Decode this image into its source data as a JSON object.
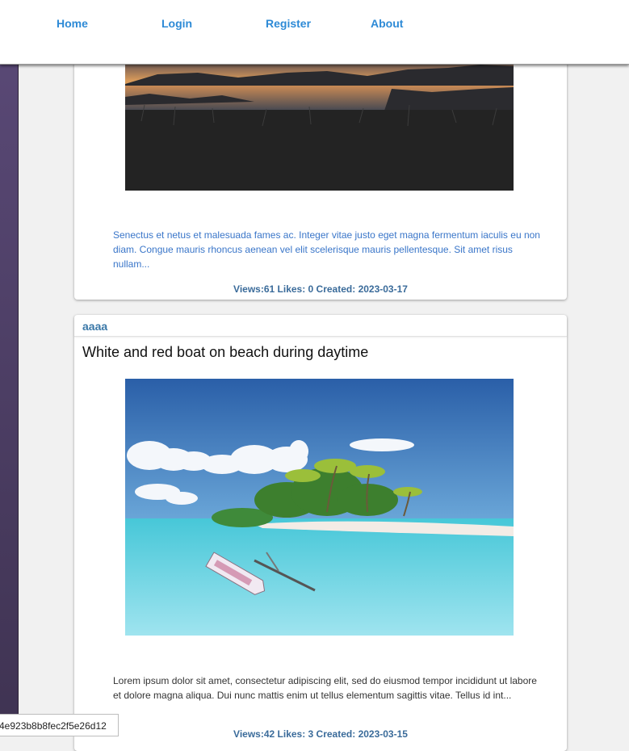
{
  "nav": {
    "home": "Home",
    "login": "Login",
    "register": "Register",
    "about": "About"
  },
  "posts": [
    {
      "image": "sunset-lake-image",
      "excerpt": "Senectus et netus et malesuada fames ac. Integer vitae justo eget magna fermentum iaculis eu non diam. Congue mauris rhoncus aenean vel elit scelerisque mauris pellentesque. Sit amet risus nullam...",
      "meta": "Views:61 Likes: 0 Created: 2023-03-17"
    },
    {
      "author": "aaaa",
      "title": "White and red boat on beach during daytime",
      "image": "tropical-island-boat-image",
      "excerpt": "Lorem ipsum dolor sit amet, consectetur adipiscing elit, sed do eiusmod tempor incididunt ut labore et dolore magna aliqua. Dui nunc mattis enim ut tellus elementum sagittis vitae. Tellus id int...",
      "meta": "Views:42 Likes: 3 Created: 2023-03-15"
    }
  ],
  "tooltip": {
    "text": "4e923b8b8fec2f5e26d12"
  },
  "colors": {
    "link": "#2d8ad6",
    "author": "#3a78a8",
    "meta": "#3a6b9a",
    "sidebar": "#4f4066"
  }
}
